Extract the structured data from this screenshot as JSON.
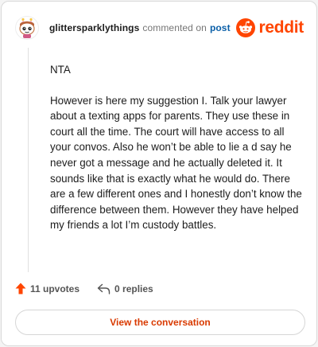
{
  "comment": {
    "username": "glittersparklythings",
    "action_text": "commented on",
    "post_link": "post",
    "paragraphs": [
      "NTA",
      "However is here my suggestion I. Talk your lawyer about a texting apps for parents. They use these in court all the time. The court will have access to all your convos. Also he won’t be able to lie a d say he never got a message and he actually deleted it. It sounds like that is exactly what he would do. There are a few different ones and I honestly don’t know the difference between them. However they have helped my friends a lot I’m custody battles."
    ]
  },
  "brand": {
    "wordmark": "reddit",
    "color": "#ff4500"
  },
  "actions": {
    "upvotes": "11 upvotes",
    "replies": "0 replies"
  },
  "cta": {
    "label": "View the conversation"
  },
  "icons": {
    "avatar": "snoo-avatar-icon",
    "logo": "reddit-logo-icon",
    "upvote": "upvote-arrow-icon",
    "reply": "reply-arrow-icon"
  }
}
